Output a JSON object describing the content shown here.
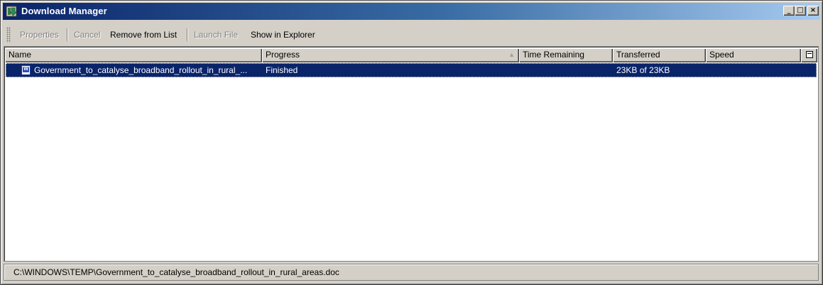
{
  "window": {
    "title": "Download Manager",
    "icon": "download-manager-icon",
    "controls": {
      "minimize": "_",
      "maximize": "□",
      "close": "×"
    }
  },
  "toolbar": {
    "properties_label": "Properties",
    "cancel_label": "Cancel",
    "remove_label": "Remove from List",
    "launch_label": "Launch File",
    "show_label": "Show in Explorer"
  },
  "columns": {
    "name": "Name",
    "progress": "Progress",
    "time_remaining": "Time Remaining",
    "transferred": "Transferred",
    "speed": "Speed",
    "sort_indicator": "▲"
  },
  "downloads": [
    {
      "name": "Government_to_catalyse_broadband_rollout_in_rural_...",
      "progress": "Finished",
      "time_remaining": "",
      "transferred": "23KB of 23KB",
      "speed": "",
      "icon": "word-document-icon",
      "selected": true
    }
  ],
  "status": {
    "path": "C:\\WINDOWS\\TEMP\\Government_to_catalyse_broadband_rollout_in_rural_areas.doc"
  },
  "colors": {
    "title_gradient_start": "#0a246a",
    "title_gradient_end": "#a6caf0",
    "selection": "#0a246a",
    "face": "#d4d0c8"
  }
}
